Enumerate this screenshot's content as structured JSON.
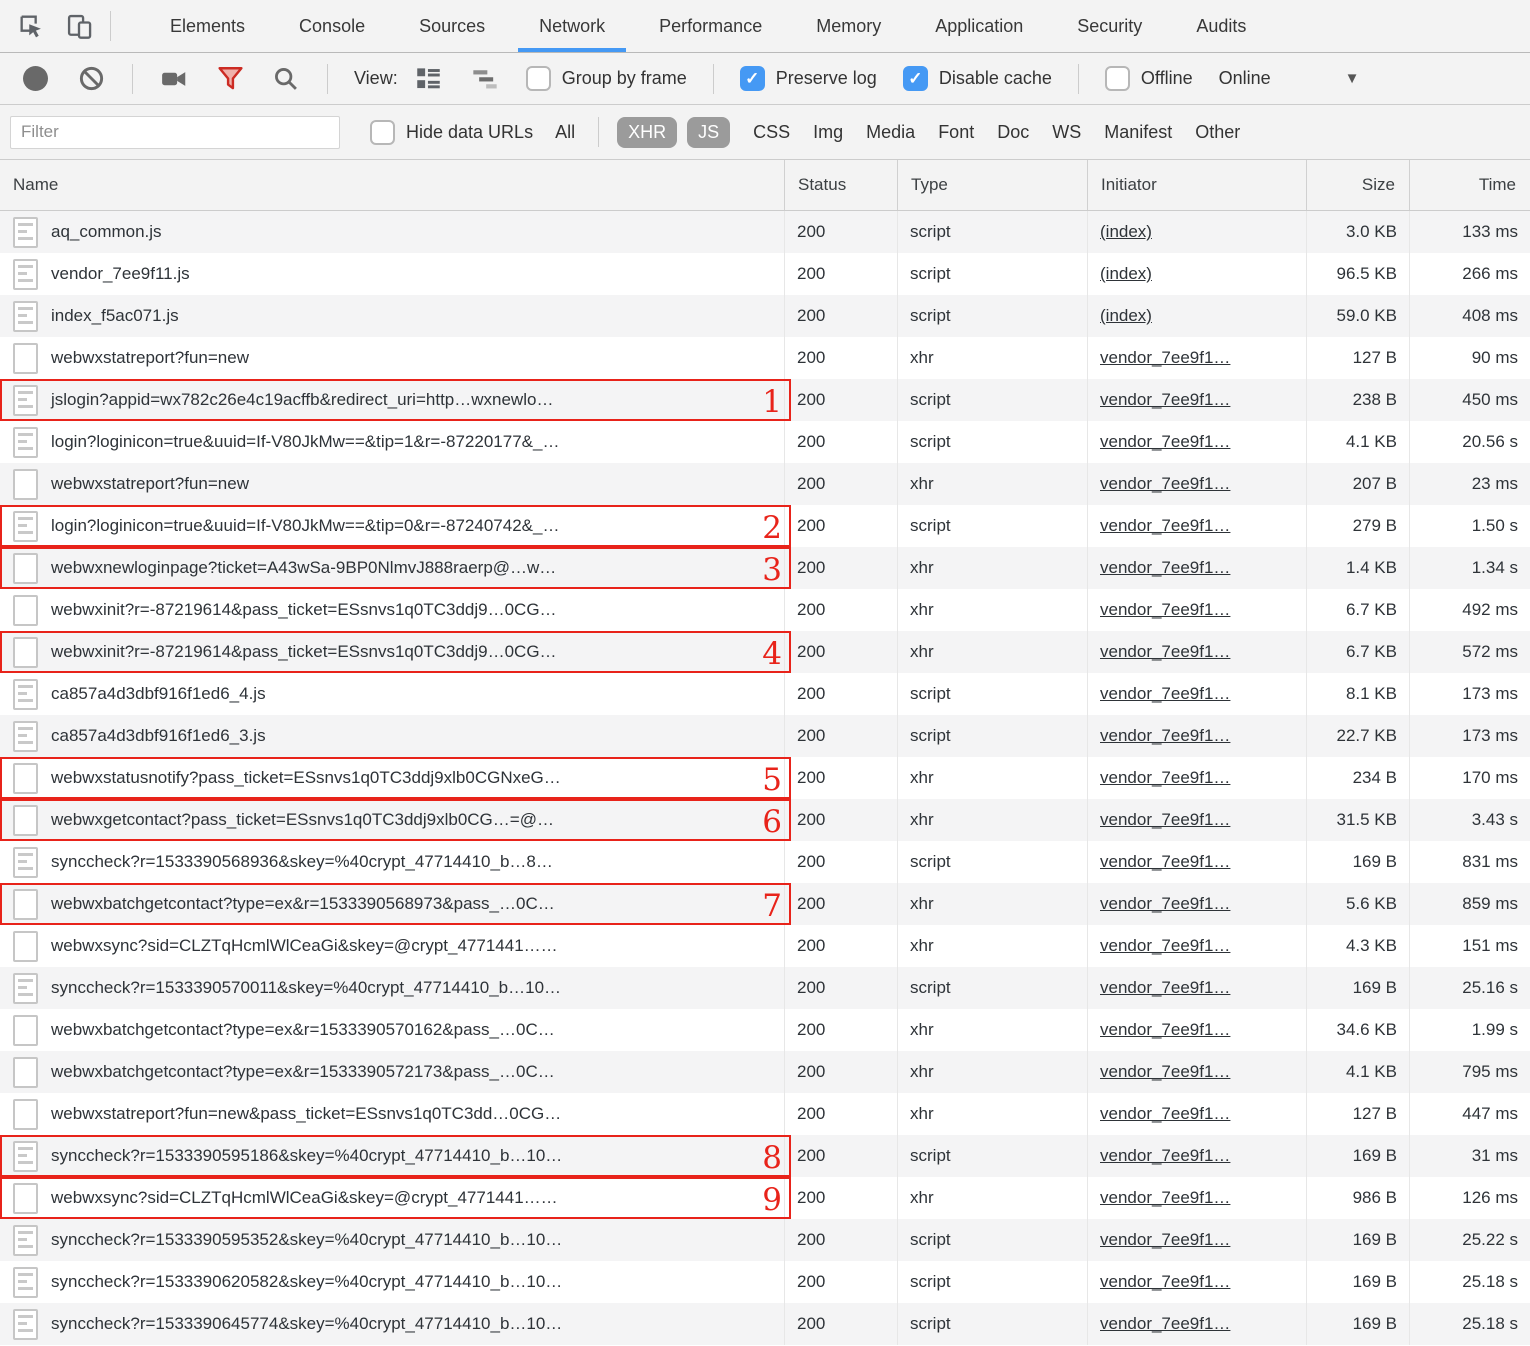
{
  "tabs": {
    "active": "Network",
    "items": [
      "Elements",
      "Console",
      "Sources",
      "Network",
      "Performance",
      "Memory",
      "Application",
      "Security",
      "Audits"
    ]
  },
  "toolbar": {
    "view_label": "View:",
    "group_by_frame": "Group by frame",
    "preserve_log": "Preserve log",
    "disable_cache": "Disable cache",
    "offline": "Offline",
    "online": "Online",
    "checked": {
      "group_by_frame": false,
      "preserve_log": true,
      "disable_cache": true,
      "offline": false
    }
  },
  "filter_bar": {
    "placeholder": "Filter",
    "hide_data_urls": "Hide data URLs",
    "all_label": "All",
    "types": [
      "XHR",
      "JS",
      "CSS",
      "Img",
      "Media",
      "Font",
      "Doc",
      "WS",
      "Manifest",
      "Other"
    ],
    "active_types": [
      "XHR",
      "JS"
    ]
  },
  "table": {
    "columns": [
      "Name",
      "Status",
      "Type",
      "Initiator",
      "Size",
      "Time"
    ],
    "rows": [
      {
        "name": "aq_common.js",
        "icon": "script",
        "status": "200",
        "type": "script",
        "initiator": "(index)",
        "size": "3.0 KB",
        "time": "133 ms"
      },
      {
        "name": "vendor_7ee9f11.js",
        "icon": "script",
        "status": "200",
        "type": "script",
        "initiator": "(index)",
        "size": "96.5 KB",
        "time": "266 ms"
      },
      {
        "name": "index_f5ac071.js",
        "icon": "script",
        "status": "200",
        "type": "script",
        "initiator": "(index)",
        "size": "59.0 KB",
        "time": "408 ms"
      },
      {
        "name": "webwxstatreport?fun=new",
        "icon": "xhr",
        "status": "200",
        "type": "xhr",
        "initiator": "vendor_7ee9f1…",
        "size": "127 B",
        "time": "90 ms"
      },
      {
        "name": "jslogin?appid=wx782c26e4c19acffb&redirect_uri=http…wxnewlo…",
        "icon": "script",
        "status": "200",
        "type": "script",
        "initiator": "vendor_7ee9f1…",
        "size": "238 B",
        "time": "450 ms",
        "annotation": "1"
      },
      {
        "name": "login?loginicon=true&uuid=If-V80JkMw==&tip=1&r=-87220177&_…",
        "icon": "script",
        "status": "200",
        "type": "script",
        "initiator": "vendor_7ee9f1…",
        "size": "4.1 KB",
        "time": "20.56 s"
      },
      {
        "name": "webwxstatreport?fun=new",
        "icon": "xhr",
        "status": "200",
        "type": "xhr",
        "initiator": "vendor_7ee9f1…",
        "size": "207 B",
        "time": "23 ms"
      },
      {
        "name": "login?loginicon=true&uuid=If-V80JkMw==&tip=0&r=-87240742&_…",
        "icon": "script",
        "status": "200",
        "type": "script",
        "initiator": "vendor_7ee9f1…",
        "size": "279 B",
        "time": "1.50 s",
        "annotation": "2"
      },
      {
        "name": "webwxnewloginpage?ticket=A43wSa-9BP0NlmvJ888raerp@…w…",
        "icon": "xhr",
        "status": "200",
        "type": "xhr",
        "initiator": "vendor_7ee9f1…",
        "size": "1.4 KB",
        "time": "1.34 s",
        "annotation": "3"
      },
      {
        "name": "webwxinit?r=-87219614&pass_ticket=ESsnvs1q0TC3ddj9…0CG…",
        "icon": "xhr",
        "status": "200",
        "type": "xhr",
        "initiator": "vendor_7ee9f1…",
        "size": "6.7 KB",
        "time": "492 ms"
      },
      {
        "name": "webwxinit?r=-87219614&pass_ticket=ESsnvs1q0TC3ddj9…0CG…",
        "icon": "xhr",
        "status": "200",
        "type": "xhr",
        "initiator": "vendor_7ee9f1…",
        "size": "6.7 KB",
        "time": "572 ms",
        "annotation": "4"
      },
      {
        "name": "ca857a4d3dbf916f1ed6_4.js",
        "icon": "script",
        "status": "200",
        "type": "script",
        "initiator": "vendor_7ee9f1…",
        "size": "8.1 KB",
        "time": "173 ms"
      },
      {
        "name": "ca857a4d3dbf916f1ed6_3.js",
        "icon": "script",
        "status": "200",
        "type": "script",
        "initiator": "vendor_7ee9f1…",
        "size": "22.7 KB",
        "time": "173 ms"
      },
      {
        "name": "webwxstatusnotify?pass_ticket=ESsnvs1q0TC3ddj9xlb0CGNxeG…",
        "icon": "xhr",
        "status": "200",
        "type": "xhr",
        "initiator": "vendor_7ee9f1…",
        "size": "234 B",
        "time": "170 ms",
        "annotation": "5"
      },
      {
        "name": "webwxgetcontact?pass_ticket=ESsnvs1q0TC3ddj9xlb0CG…=@…",
        "icon": "xhr",
        "status": "200",
        "type": "xhr",
        "initiator": "vendor_7ee9f1…",
        "size": "31.5 KB",
        "time": "3.43 s",
        "annotation": "6"
      },
      {
        "name": "synccheck?r=1533390568936&skey=%40crypt_47714410_b…8…",
        "icon": "script",
        "status": "200",
        "type": "script",
        "initiator": "vendor_7ee9f1…",
        "size": "169 B",
        "time": "831 ms"
      },
      {
        "name": "webwxbatchgetcontact?type=ex&r=1533390568973&pass_…0C…",
        "icon": "xhr",
        "status": "200",
        "type": "xhr",
        "initiator": "vendor_7ee9f1…",
        "size": "5.6 KB",
        "time": "859 ms",
        "annotation": "7"
      },
      {
        "name": "webwxsync?sid=CLZTqHcmlWlCeaGi&skey=@crypt_4771441……",
        "icon": "xhr",
        "status": "200",
        "type": "xhr",
        "initiator": "vendor_7ee9f1…",
        "size": "4.3 KB",
        "time": "151 ms"
      },
      {
        "name": "synccheck?r=1533390570011&skey=%40crypt_47714410_b…10…",
        "icon": "script",
        "status": "200",
        "type": "script",
        "initiator": "vendor_7ee9f1…",
        "size": "169 B",
        "time": "25.16 s"
      },
      {
        "name": "webwxbatchgetcontact?type=ex&r=1533390570162&pass_…0C…",
        "icon": "xhr",
        "status": "200",
        "type": "xhr",
        "initiator": "vendor_7ee9f1…",
        "size": "34.6 KB",
        "time": "1.99 s"
      },
      {
        "name": "webwxbatchgetcontact?type=ex&r=1533390572173&pass_…0C…",
        "icon": "xhr",
        "status": "200",
        "type": "xhr",
        "initiator": "vendor_7ee9f1…",
        "size": "4.1 KB",
        "time": "795 ms"
      },
      {
        "name": "webwxstatreport?fun=new&pass_ticket=ESsnvs1q0TC3dd…0CG…",
        "icon": "xhr",
        "status": "200",
        "type": "xhr",
        "initiator": "vendor_7ee9f1…",
        "size": "127 B",
        "time": "447 ms"
      },
      {
        "name": "synccheck?r=1533390595186&skey=%40crypt_47714410_b…10…",
        "icon": "script",
        "status": "200",
        "type": "script",
        "initiator": "vendor_7ee9f1…",
        "size": "169 B",
        "time": "31 ms",
        "annotation": "8"
      },
      {
        "name": "webwxsync?sid=CLZTqHcmlWlCeaGi&skey=@crypt_4771441……",
        "icon": "xhr",
        "status": "200",
        "type": "xhr",
        "initiator": "vendor_7ee9f1…",
        "size": "986 B",
        "time": "126 ms",
        "annotation": "9"
      },
      {
        "name": "synccheck?r=1533390595352&skey=%40crypt_47714410_b…10…",
        "icon": "script",
        "status": "200",
        "type": "script",
        "initiator": "vendor_7ee9f1…",
        "size": "169 B",
        "time": "25.22 s"
      },
      {
        "name": "synccheck?r=1533390620582&skey=%40crypt_47714410_b…10…",
        "icon": "script",
        "status": "200",
        "type": "script",
        "initiator": "vendor_7ee9f1…",
        "size": "169 B",
        "time": "25.18 s"
      },
      {
        "name": "synccheck?r=1533390645774&skey=%40crypt_47714410_b…10…",
        "icon": "script",
        "status": "200",
        "type": "script",
        "initiator": "vendor_7ee9f1…",
        "size": "169 B",
        "time": "25.18 s"
      }
    ]
  },
  "colors": {
    "active_tab_underline": "#4599f4",
    "checkbox_checked_blue": "#4599f4",
    "annotation_red": "#e8231a",
    "filter_funnel_red": "#cc2b23",
    "row_stripe": "#f4f4f5",
    "chrome_background": "#f3f3f3"
  }
}
